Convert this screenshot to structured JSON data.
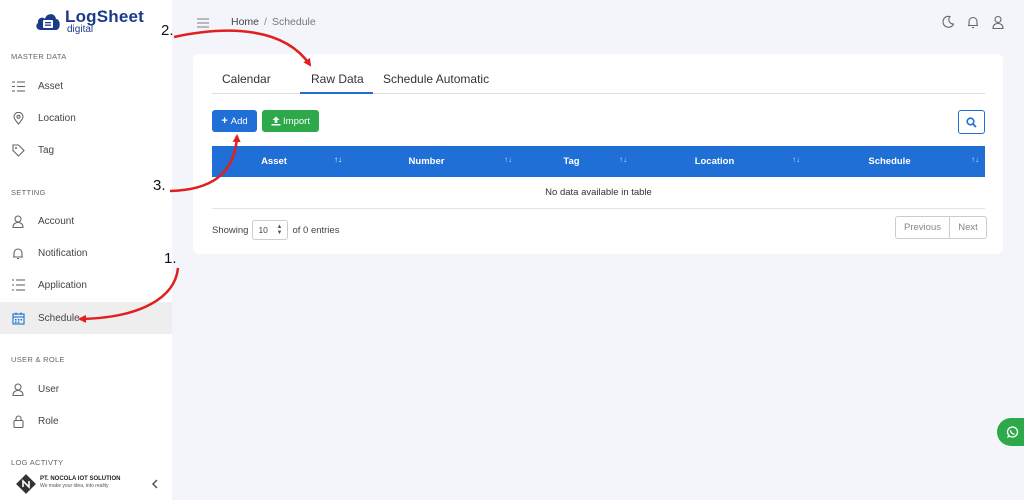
{
  "brand": {
    "title": "LogSheet",
    "subtitle": "digital"
  },
  "sidebar": {
    "sections": [
      {
        "title": "MASTER DATA"
      },
      {
        "title": "SETTING"
      },
      {
        "title": "USER & ROLE"
      },
      {
        "title": "LOG ACTIVTY"
      }
    ],
    "items": [
      {
        "label": "Asset",
        "icon": "list-icon"
      },
      {
        "label": "Location",
        "icon": "map-pin-icon"
      },
      {
        "label": "Tag",
        "icon": "tag-icon"
      },
      {
        "label": "Account",
        "icon": "user-icon"
      },
      {
        "label": "Notification",
        "icon": "bell-icon"
      },
      {
        "label": "Application",
        "icon": "list-check-icon"
      },
      {
        "label": "Schedule",
        "icon": "calendar-icon",
        "active": true
      },
      {
        "label": "User",
        "icon": "user-icon"
      },
      {
        "label": "Role",
        "icon": "lock-icon"
      }
    ],
    "company": {
      "name": "PT. NOCOLA IOT SOLUTION",
      "tagline": "We make your idea, into reality"
    }
  },
  "breadcrumb": {
    "home": "Home",
    "separator": "/",
    "current": "Schedule"
  },
  "tabs": [
    {
      "label": "Calendar"
    },
    {
      "label": "Raw Data",
      "active": true
    },
    {
      "label": "Schedule Automatic"
    }
  ],
  "buttons": {
    "add": "Add",
    "import": "Import"
  },
  "table": {
    "columns": [
      "Asset",
      "Number",
      "Tag",
      "Location",
      "Schedule"
    ],
    "empty_text": "No data available in table"
  },
  "footer": {
    "showing": "Showing",
    "page_size": "10",
    "entries": "of 0 entries",
    "previous": "Previous",
    "next": "Next"
  },
  "annotations": {
    "step1": "1.",
    "step2": "2.",
    "step3": "3."
  },
  "colors": {
    "primary": "#1f6fd6",
    "success": "#2ea94a",
    "annotation": "#e0201f",
    "brand": "#1d3a8a"
  }
}
